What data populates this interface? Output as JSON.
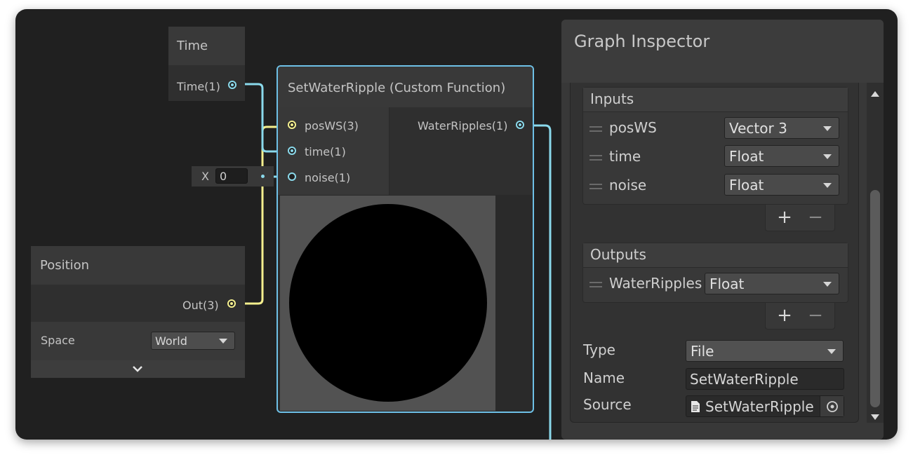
{
  "colors": {
    "vector3_wire": "#f4ef8e",
    "float_wire": "#8ad9eb",
    "selection": "#6ec0e6"
  },
  "time_node": {
    "title": "Time",
    "output_label": "Time(1)"
  },
  "position_node": {
    "title": "Position",
    "output_label": "Out(3)",
    "space_label": "Space",
    "space_value": "World",
    "expand_icon": "chevron-down-icon"
  },
  "noise_input": {
    "axis_label": "X",
    "value": "0"
  },
  "custom_function_node": {
    "title": "SetWaterRipple (Custom Function)",
    "inputs": [
      "posWS(3)",
      "time(1)",
      "noise(1)"
    ],
    "output_label": "WaterRipples(1)"
  },
  "inspector": {
    "title": "Graph Inspector",
    "inputs_header": "Inputs",
    "inputs": [
      {
        "name": "posWS",
        "type": "Vector 3"
      },
      {
        "name": "time",
        "type": "Float"
      },
      {
        "name": "noise",
        "type": "Float"
      }
    ],
    "outputs_header": "Outputs",
    "outputs": [
      {
        "name": "WaterRipples",
        "type": "Float"
      }
    ],
    "add_label": "+",
    "remove_label": "−",
    "type_label": "Type",
    "type_value": "File",
    "name_label": "Name",
    "name_value": "SetWaterRipple",
    "source_label": "Source",
    "source_value": "SetWaterRipple",
    "source_icon": "file-icon",
    "picker_icon": "object-picker-icon"
  }
}
